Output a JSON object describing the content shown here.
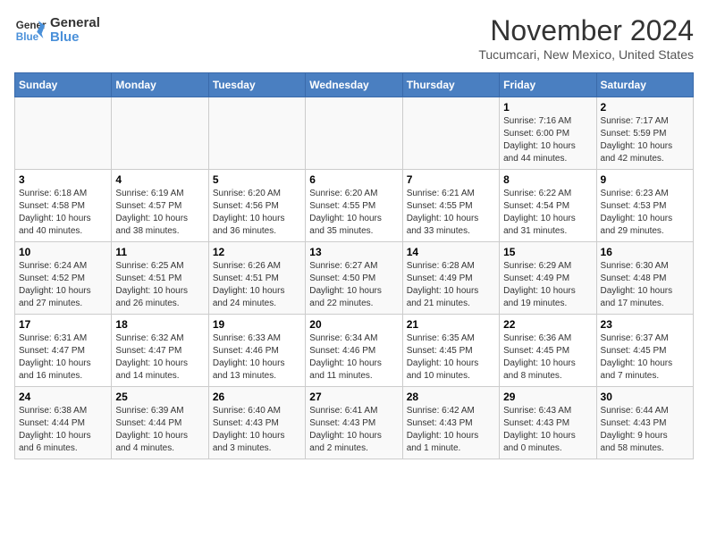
{
  "header": {
    "logo_line1": "General",
    "logo_line2": "Blue",
    "month": "November 2024",
    "location": "Tucumcari, New Mexico, United States"
  },
  "days_of_week": [
    "Sunday",
    "Monday",
    "Tuesday",
    "Wednesday",
    "Thursday",
    "Friday",
    "Saturday"
  ],
  "weeks": [
    [
      {
        "num": "",
        "detail": ""
      },
      {
        "num": "",
        "detail": ""
      },
      {
        "num": "",
        "detail": ""
      },
      {
        "num": "",
        "detail": ""
      },
      {
        "num": "",
        "detail": ""
      },
      {
        "num": "1",
        "detail": "Sunrise: 7:16 AM\nSunset: 6:00 PM\nDaylight: 10 hours\nand 44 minutes."
      },
      {
        "num": "2",
        "detail": "Sunrise: 7:17 AM\nSunset: 5:59 PM\nDaylight: 10 hours\nand 42 minutes."
      }
    ],
    [
      {
        "num": "3",
        "detail": "Sunrise: 6:18 AM\nSunset: 4:58 PM\nDaylight: 10 hours\nand 40 minutes."
      },
      {
        "num": "4",
        "detail": "Sunrise: 6:19 AM\nSunset: 4:57 PM\nDaylight: 10 hours\nand 38 minutes."
      },
      {
        "num": "5",
        "detail": "Sunrise: 6:20 AM\nSunset: 4:56 PM\nDaylight: 10 hours\nand 36 minutes."
      },
      {
        "num": "6",
        "detail": "Sunrise: 6:20 AM\nSunset: 4:55 PM\nDaylight: 10 hours\nand 35 minutes."
      },
      {
        "num": "7",
        "detail": "Sunrise: 6:21 AM\nSunset: 4:55 PM\nDaylight: 10 hours\nand 33 minutes."
      },
      {
        "num": "8",
        "detail": "Sunrise: 6:22 AM\nSunset: 4:54 PM\nDaylight: 10 hours\nand 31 minutes."
      },
      {
        "num": "9",
        "detail": "Sunrise: 6:23 AM\nSunset: 4:53 PM\nDaylight: 10 hours\nand 29 minutes."
      }
    ],
    [
      {
        "num": "10",
        "detail": "Sunrise: 6:24 AM\nSunset: 4:52 PM\nDaylight: 10 hours\nand 27 minutes."
      },
      {
        "num": "11",
        "detail": "Sunrise: 6:25 AM\nSunset: 4:51 PM\nDaylight: 10 hours\nand 26 minutes."
      },
      {
        "num": "12",
        "detail": "Sunrise: 6:26 AM\nSunset: 4:51 PM\nDaylight: 10 hours\nand 24 minutes."
      },
      {
        "num": "13",
        "detail": "Sunrise: 6:27 AM\nSunset: 4:50 PM\nDaylight: 10 hours\nand 22 minutes."
      },
      {
        "num": "14",
        "detail": "Sunrise: 6:28 AM\nSunset: 4:49 PM\nDaylight: 10 hours\nand 21 minutes."
      },
      {
        "num": "15",
        "detail": "Sunrise: 6:29 AM\nSunset: 4:49 PM\nDaylight: 10 hours\nand 19 minutes."
      },
      {
        "num": "16",
        "detail": "Sunrise: 6:30 AM\nSunset: 4:48 PM\nDaylight: 10 hours\nand 17 minutes."
      }
    ],
    [
      {
        "num": "17",
        "detail": "Sunrise: 6:31 AM\nSunset: 4:47 PM\nDaylight: 10 hours\nand 16 minutes."
      },
      {
        "num": "18",
        "detail": "Sunrise: 6:32 AM\nSunset: 4:47 PM\nDaylight: 10 hours\nand 14 minutes."
      },
      {
        "num": "19",
        "detail": "Sunrise: 6:33 AM\nSunset: 4:46 PM\nDaylight: 10 hours\nand 13 minutes."
      },
      {
        "num": "20",
        "detail": "Sunrise: 6:34 AM\nSunset: 4:46 PM\nDaylight: 10 hours\nand 11 minutes."
      },
      {
        "num": "21",
        "detail": "Sunrise: 6:35 AM\nSunset: 4:45 PM\nDaylight: 10 hours\nand 10 minutes."
      },
      {
        "num": "22",
        "detail": "Sunrise: 6:36 AM\nSunset: 4:45 PM\nDaylight: 10 hours\nand 8 minutes."
      },
      {
        "num": "23",
        "detail": "Sunrise: 6:37 AM\nSunset: 4:45 PM\nDaylight: 10 hours\nand 7 minutes."
      }
    ],
    [
      {
        "num": "24",
        "detail": "Sunrise: 6:38 AM\nSunset: 4:44 PM\nDaylight: 10 hours\nand 6 minutes."
      },
      {
        "num": "25",
        "detail": "Sunrise: 6:39 AM\nSunset: 4:44 PM\nDaylight: 10 hours\nand 4 minutes."
      },
      {
        "num": "26",
        "detail": "Sunrise: 6:40 AM\nSunset: 4:43 PM\nDaylight: 10 hours\nand 3 minutes."
      },
      {
        "num": "27",
        "detail": "Sunrise: 6:41 AM\nSunset: 4:43 PM\nDaylight: 10 hours\nand 2 minutes."
      },
      {
        "num": "28",
        "detail": "Sunrise: 6:42 AM\nSunset: 4:43 PM\nDaylight: 10 hours\nand 1 minute."
      },
      {
        "num": "29",
        "detail": "Sunrise: 6:43 AM\nSunset: 4:43 PM\nDaylight: 10 hours\nand 0 minutes."
      },
      {
        "num": "30",
        "detail": "Sunrise: 6:44 AM\nSunset: 4:43 PM\nDaylight: 9 hours\nand 58 minutes."
      }
    ]
  ]
}
